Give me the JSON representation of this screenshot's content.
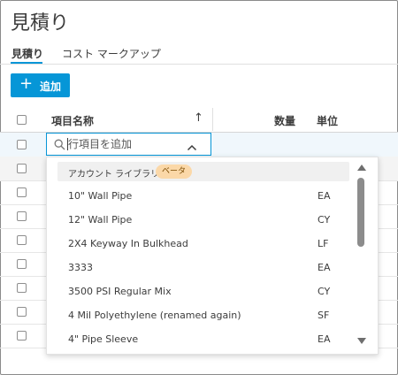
{
  "page": {
    "title": "見積り"
  },
  "tabs": [
    {
      "label": "見積り",
      "active": true
    },
    {
      "label": "コスト マークアップ",
      "active": false
    }
  ],
  "toolbar": {
    "add_label": "追加",
    "add_icon": "plus-icon"
  },
  "table": {
    "columns": {
      "name": "項目名称",
      "quantity": "数量",
      "unit": "単位"
    },
    "sort_icon": "arrow-up-icon",
    "add_row": {
      "placeholder": "行項目を追加",
      "value": ""
    }
  },
  "dropdown": {
    "header": "アカウント ライブラリ",
    "badge": "ベータ",
    "items": [
      {
        "name": "10\" Wall Pipe",
        "unit": "EA"
      },
      {
        "name": "12\" Wall Pipe",
        "unit": "CY"
      },
      {
        "name": "2X4 Keyway In Bulkhead",
        "unit": "LF"
      },
      {
        "name": "3333",
        "unit": "EA"
      },
      {
        "name": "3500 PSI Regular Mix",
        "unit": "CY"
      },
      {
        "name": "4 Mil Polyethylene (renamed again)",
        "unit": "SF"
      },
      {
        "name": "4\" Pipe Sleeve",
        "unit": "EA"
      }
    ]
  },
  "colors": {
    "accent": "#0696d7",
    "badge_bg": "#fbd8a8"
  }
}
